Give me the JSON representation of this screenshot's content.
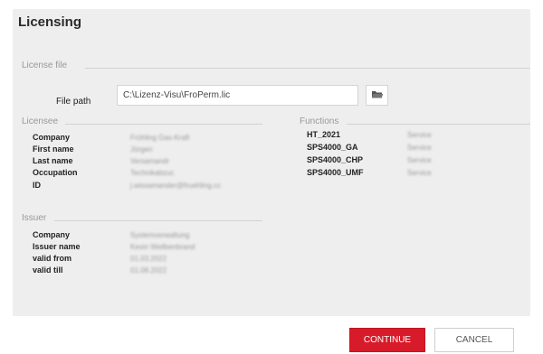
{
  "dialog": {
    "title": "Licensing"
  },
  "license_file": {
    "section_label": "License file",
    "file_path_label": "File path",
    "file_path_value": "C:\\Lizenz-Visu\\FroPerm.lic",
    "browse_icon": "folder-open-icon"
  },
  "licensee": {
    "section_label": "Licensee",
    "rows": [
      {
        "label": "Company",
        "value": "Frühling Gas-Kraft"
      },
      {
        "label": "First name",
        "value": "Jürgen"
      },
      {
        "label": "Last name",
        "value": "Versamandr"
      },
      {
        "label": "Occupation",
        "value": "Technikabzuc"
      },
      {
        "label": "ID",
        "value": "j.wissamander@fruehling.cc"
      }
    ]
  },
  "issuer": {
    "section_label": "Issuer",
    "rows": [
      {
        "label": "Company",
        "value": "Systemverwaltung"
      },
      {
        "label": "Issuer name",
        "value": "Kevin Weilbenbrand"
      },
      {
        "label": "valid from",
        "value": "01.03.2022"
      },
      {
        "label": "valid till",
        "value": "01.08.2022"
      }
    ]
  },
  "functions": {
    "section_label": "Functions",
    "rows": [
      {
        "label": "HT_2021",
        "value": "Service"
      },
      {
        "label": "SPS4000_GA",
        "value": "Service"
      },
      {
        "label": "SPS4000_CHP",
        "value": "Service"
      },
      {
        "label": "SPS4000_UMF",
        "value": "Service"
      }
    ]
  },
  "buttons": {
    "continue_label": "CONTINUE",
    "cancel_label": "CANCEL"
  },
  "colors": {
    "accent": "#d81b2a",
    "panel_bg": "#eeeeee"
  }
}
